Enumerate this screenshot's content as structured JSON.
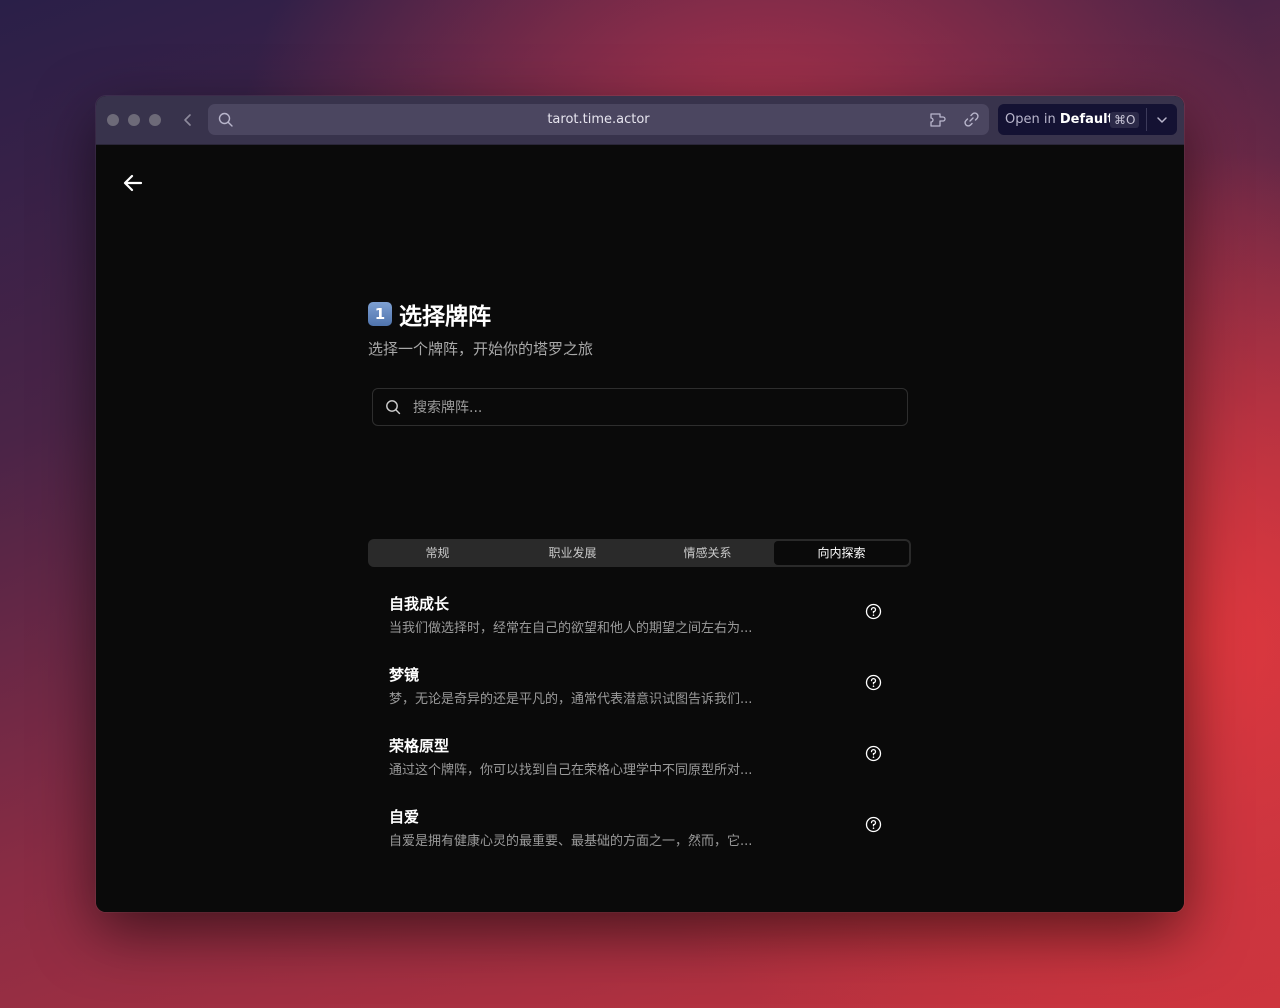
{
  "browser": {
    "url": "tarot.time.actor",
    "open_in_prefix": "Open in",
    "open_in_target": "Default",
    "open_in_shortcut": "⌘O"
  },
  "page": {
    "step_badge": "1",
    "title": "选择牌阵",
    "subtitle": "选择一个牌阵，开始你的塔罗之旅",
    "search_placeholder": "搜索牌阵..."
  },
  "tabs": [
    {
      "label": "常规",
      "active": false
    },
    {
      "label": "职业发展",
      "active": false
    },
    {
      "label": "情感关系",
      "active": false
    },
    {
      "label": "向内探索",
      "active": true
    }
  ],
  "spreads": [
    {
      "title": "自我成长",
      "description": "当我们做选择时，经常在自己的欲望和他人的期望之间左右为..."
    },
    {
      "title": "梦镜",
      "description": "梦，无论是奇异的还是平凡的，通常代表潜意识试图告诉我们..."
    },
    {
      "title": "荣格原型",
      "description": "通过这个牌阵，你可以找到自己在荣格心理学中不同原型所对..."
    },
    {
      "title": "自爱",
      "description": "自爱是拥有健康心灵的最重要、最基础的方面之一，然而，它..."
    }
  ],
  "icons": {
    "back": "arrow-left-icon",
    "search": "search-icon",
    "help": "question-circle-icon"
  }
}
